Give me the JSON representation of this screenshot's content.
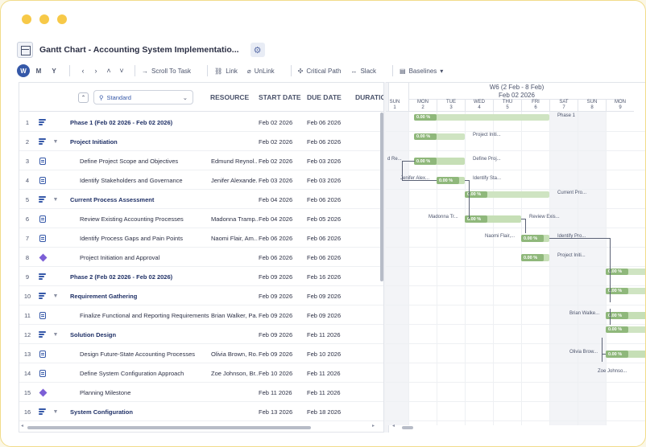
{
  "window": {
    "title": "Gantt Chart - Accounting System Implementatio..."
  },
  "toolbar": {
    "views": [
      {
        "label": "W",
        "active": true
      },
      {
        "label": "M",
        "active": false
      },
      {
        "label": "Y",
        "active": false
      }
    ],
    "scroll_to_task": "Scroll To Task",
    "link": "Link",
    "unlink": "UnLink",
    "critical_path": "Critical Path",
    "slack": "Slack",
    "baselines": "Baselines"
  },
  "grid": {
    "view_selector": "Standard",
    "columns": {
      "resource": "RESOURCE",
      "start": "START DATE",
      "due": "DUE DATE",
      "duration": "DURATION"
    },
    "rows": [
      {
        "num": "1",
        "type": "phase",
        "name": "Phase 1 (Feb 02 2026 - Feb 02 2026)",
        "resource": "",
        "start": "Feb 02 2026",
        "due": "Feb 06 2026"
      },
      {
        "num": "2",
        "type": "group",
        "name": "Project Initiation",
        "resource": "",
        "start": "Feb 02 2026",
        "due": "Feb 06 2026"
      },
      {
        "num": "3",
        "type": "task",
        "name": "Define Project Scope and Objectives",
        "resource": "Edmund Reynol...",
        "start": "Feb 02 2026",
        "due": "Feb 03 2026"
      },
      {
        "num": "4",
        "type": "task",
        "name": "Identify Stakeholders and Governance",
        "resource": "Jenifer Alexande...",
        "start": "Feb 03 2026",
        "due": "Feb 03 2026"
      },
      {
        "num": "5",
        "type": "group",
        "name": "Current Process Assessment",
        "resource": "",
        "start": "Feb 04 2026",
        "due": "Feb 06 2026"
      },
      {
        "num": "6",
        "type": "task",
        "name": "Review Existing Accounting Processes",
        "resource": "Madonna Tramp...",
        "start": "Feb 04 2026",
        "due": "Feb 05 2026"
      },
      {
        "num": "7",
        "type": "task",
        "name": "Identify Process Gaps and Pain Points",
        "resource": "Naomi Flair, Am...",
        "start": "Feb 06 2026",
        "due": "Feb 06 2026"
      },
      {
        "num": "8",
        "type": "milestone",
        "name": "Project Initiation and Approval",
        "resource": "",
        "start": "Feb 06 2026",
        "due": "Feb 06 2026"
      },
      {
        "num": "9",
        "type": "phase",
        "name": "Phase 2 (Feb 02 2026 - Feb 02 2026)",
        "resource": "",
        "start": "Feb 09 2026",
        "due": "Feb 16 2026"
      },
      {
        "num": "10",
        "type": "group",
        "name": "Requirement Gathering",
        "resource": "",
        "start": "Feb 09 2026",
        "due": "Feb 09 2026"
      },
      {
        "num": "11",
        "type": "task",
        "name": "Finalize Functional and Reporting Requirements",
        "resource": "Brian Walker, Pa...",
        "start": "Feb 09 2026",
        "due": "Feb 09 2026"
      },
      {
        "num": "12",
        "type": "group",
        "name": "Solution Design",
        "resource": "",
        "start": "Feb 09 2026",
        "due": "Feb 11 2026"
      },
      {
        "num": "13",
        "type": "task",
        "name": "Design Future-State Accounting Processes",
        "resource": "Olivia Brown, Ro...",
        "start": "Feb 09 2026",
        "due": "Feb 10 2026"
      },
      {
        "num": "14",
        "type": "task",
        "name": "Define System Configuration Approach",
        "resource": "Zoe Johnson, Br...",
        "start": "Feb 10 2026",
        "due": "Feb 11 2026"
      },
      {
        "num": "15",
        "type": "milestone",
        "name": "Planning Milestone",
        "resource": "",
        "start": "Feb 11 2026",
        "due": "Feb 11 2026"
      },
      {
        "num": "16",
        "type": "group",
        "name": "System Configuration",
        "resource": "",
        "start": "Feb 13 2026",
        "due": "Feb 18 2026"
      }
    ]
  },
  "gantt": {
    "week_label": "W6 (2 Feb - 8 Feb)",
    "month_label": "Feb 02 2026",
    "days": [
      {
        "name": "SUN",
        "num": "1"
      },
      {
        "name": "MON",
        "num": "2"
      },
      {
        "name": "TUE",
        "num": "3"
      },
      {
        "name": "WED",
        "num": "4"
      },
      {
        "name": "THU",
        "num": "5"
      },
      {
        "name": "FRI",
        "num": "6"
      },
      {
        "name": "SAT",
        "num": "7"
      },
      {
        "name": "SUN",
        "num": "8"
      },
      {
        "name": "MON",
        "num": "9"
      }
    ],
    "progress_label": "0.00 %",
    "bar_labels": {
      "r1": "Phase 1",
      "r2": "Project Initi...",
      "r3_left": "d Re...",
      "r3": "Define Proj...",
      "r4_left": "Jenifer Alex...",
      "r4": "Identify Sta...",
      "r5": "Current Pro...",
      "r6_left": "Madonna Tr...",
      "r6": "Review Exis...",
      "r7_left": "Naomi Flair,...",
      "r7": "Identify Pro...",
      "r8": "Project Initi...",
      "r11_left": "Brian Walke...",
      "r13_left": "Olivia Brow...",
      "r14_left": "Zoe Johnso..."
    }
  },
  "colors": {
    "accent": "#3558a8",
    "bar": "#c6dfb6",
    "progress": "#8fb87b",
    "milestone": "#7c5fd6",
    "window_dots": "#f7c948"
  }
}
